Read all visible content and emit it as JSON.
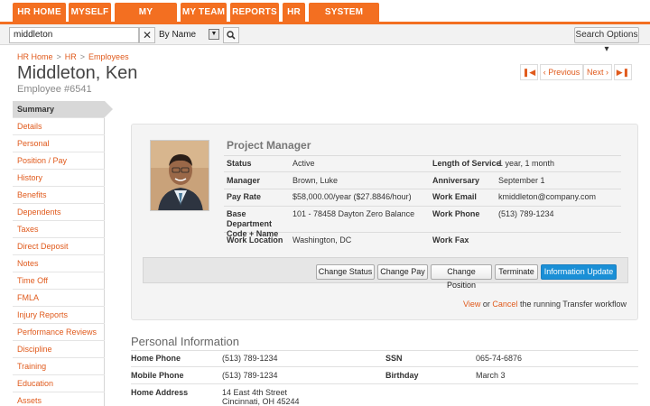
{
  "nav": {
    "tabs": [
      "HR HOME",
      "MYSELF",
      "MY COMPANY",
      "MY TEAM",
      "REPORTS",
      "HR",
      "SYSTEM SETUP"
    ]
  },
  "search": {
    "value": "middleton",
    "clear_icon": "close-icon",
    "by_label": "By Name",
    "go_icon": "search-icon",
    "options_label": "Search Options ▾"
  },
  "breadcrumb": [
    "HR Home",
    "HR",
    "Employees"
  ],
  "header": {
    "title": "Middleton, Ken",
    "subtitle": "Employee #6541"
  },
  "pager": {
    "first": "⏮",
    "previous": "‹ Previous",
    "next": "Next ›",
    "last": "⏭"
  },
  "sidebar": {
    "items": [
      "Summary",
      "Details",
      "Personal",
      "Position / Pay",
      "History",
      "Benefits",
      "Dependents",
      "Taxes",
      "Direct Deposit",
      "Notes",
      "Time Off",
      "FMLA",
      "Injury Reports",
      "Performance Reviews",
      "Discipline",
      "Training",
      "Education",
      "Assets"
    ],
    "active": "Summary"
  },
  "employee": {
    "job_title": "Project Manager",
    "fields_left": [
      {
        "label": "Status",
        "value": "Active"
      },
      {
        "label": "Manager",
        "value": "Brown, Luke"
      },
      {
        "label": "Pay Rate",
        "value": "$58,000.00/year  ($27.8846/hour)"
      },
      {
        "label": "Base Department Code + Name",
        "value": "101 - 78458 Dayton Zero Balance"
      },
      {
        "label": "Work Location",
        "value": "Washington, DC"
      }
    ],
    "fields_right": [
      {
        "label": "Length of Service",
        "value": "1 year, 1 month"
      },
      {
        "label": "Anniversary",
        "value": "September 1"
      },
      {
        "label": "Work Email",
        "value": "kmiddleton@company.com"
      },
      {
        "label": "Work Phone",
        "value": "(513) 789-1234"
      },
      {
        "label": "Work Fax",
        "value": ""
      }
    ]
  },
  "actions": {
    "change_status": "Change Status",
    "change_pay": "Change Pay",
    "change_position": "Change Position",
    "terminate": "Terminate",
    "information_update": "Information Update"
  },
  "workflow": {
    "view": "View",
    "or": "or",
    "cancel": "Cancel",
    "text": "the running Transfer workflow"
  },
  "personal": {
    "title": "Personal Information",
    "home_phone_label": "Home Phone",
    "home_phone": "(513) 789-1234",
    "ssn_label": "SSN",
    "ssn": "065-74-6876",
    "mobile_phone_label": "Mobile Phone",
    "mobile_phone": "(513) 789-1234",
    "birthday_label": "Birthday",
    "birthday": "March 3",
    "home_address_label": "Home Address",
    "home_address_line1": "14 East 4th Street",
    "home_address_line2": "Cincinnati, OH 45244"
  },
  "colors": {
    "brand_orange": "#f36f21",
    "link_orange": "#e05a1c",
    "primary_blue": "#1a8fd6"
  }
}
